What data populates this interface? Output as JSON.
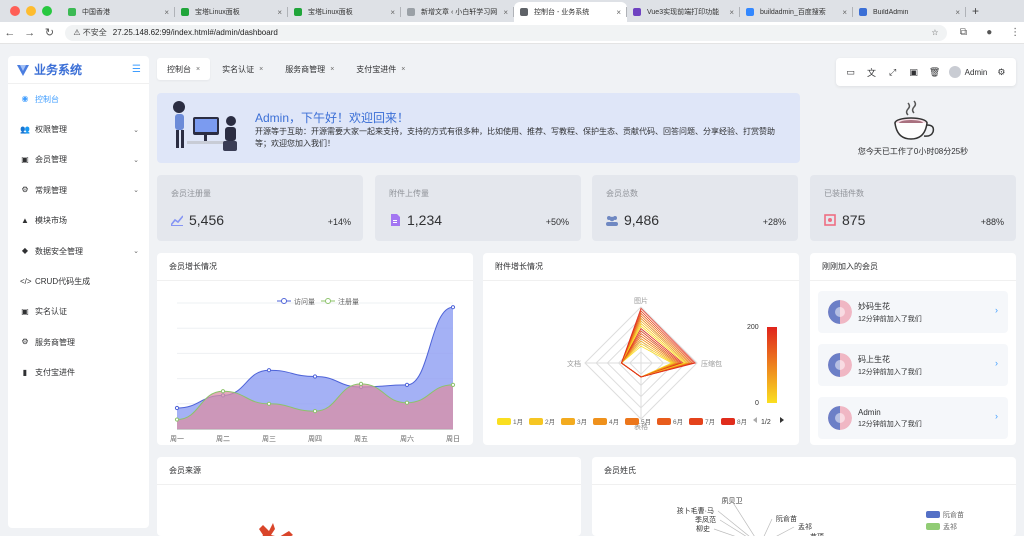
{
  "browser": {
    "tabs": [
      {
        "label": "中国香港",
        "color": "#3cba54"
      },
      {
        "label": "宝塔Linux面板",
        "color": "#20a53a"
      },
      {
        "label": "宝塔Linux面板",
        "color": "#20a53a"
      },
      {
        "label": "新增文章 ‹ 小白轩学习网",
        "color": "#9aa0a6"
      },
      {
        "label": "控制台 - 业务系统",
        "color": "#5f6368"
      },
      {
        "label": "Vue3实现前端打印功能",
        "color": "#6f42c1"
      },
      {
        "label": "buildadmin_百度搜索",
        "color": "#3388ff"
      },
      {
        "label": "BuildAdmin",
        "color": "#3b6fd6"
      }
    ],
    "active_tab": 4,
    "security_label": "不安全",
    "url": "27.25.148.62:99/index.html#/admin/dashboard"
  },
  "sidebar": {
    "title": "业务系统",
    "items": [
      {
        "label": "控制台",
        "icon": "gauge-icon",
        "glyph": "◉",
        "submenu": false
      },
      {
        "label": "权限管理",
        "icon": "users-icon",
        "glyph": "👥",
        "submenu": true
      },
      {
        "label": "会员管理",
        "icon": "id-card-icon",
        "glyph": "▣",
        "submenu": true
      },
      {
        "label": "常规管理",
        "icon": "cogs-icon",
        "glyph": "⚙",
        "submenu": true
      },
      {
        "label": "模块市场",
        "icon": "shopping-bag-icon",
        "glyph": "▲",
        "submenu": false
      },
      {
        "label": "数据安全管理",
        "icon": "shield-icon",
        "glyph": "◆",
        "submenu": true
      },
      {
        "label": "CRUD代码生成",
        "icon": "code-icon",
        "glyph": "</>",
        "submenu": false
      },
      {
        "label": "实名认证",
        "icon": "id-card-icon",
        "glyph": "▣",
        "submenu": false
      },
      {
        "label": "服务商管理",
        "icon": "gear-icon",
        "glyph": "⚙",
        "submenu": false
      },
      {
        "label": "支付宝进件",
        "icon": "bar-chart-icon",
        "glyph": "▮",
        "submenu": false
      }
    ],
    "active_index": 0
  },
  "page_tabs": [
    "控制台",
    "实名认证",
    "服务商管理",
    "支付宝进件"
  ],
  "toolbar": {
    "user": "Admin"
  },
  "welcome": {
    "title": "Admin，下午好！欢迎回来！",
    "text": "开源等于互助：开源需要大家一起来支持，支持的方式有很多种，比如使用、推荐、写教程、保护生态、贡献代码、回答问题、分享经验、打赏赞助等；欢迎您加入我们！"
  },
  "worktime": "您今天已工作了0小时08分25秒",
  "stats": [
    {
      "label": "会员注册量",
      "value": "5,456",
      "pct": "+14%",
      "color": "#8595f4"
    },
    {
      "label": "附件上传量",
      "value": "1,234",
      "pct": "+50%",
      "color": "#a376f2"
    },
    {
      "label": "会员总数",
      "value": "9,486",
      "pct": "+28%",
      "color": "#6f88c2"
    },
    {
      "label": "已装插件数",
      "value": "875",
      "pct": "+88%",
      "color": "#ee6e82"
    }
  ],
  "cards": {
    "growth": "会员增长情况",
    "attach": "附件增长情况",
    "newmembers": "刚刚加入的会员",
    "source": "会员来源",
    "surname": "会员姓氏"
  },
  "chart_data": [
    {
      "type": "area",
      "title": "会员增长情况",
      "categories": [
        "周一",
        "周二",
        "周三",
        "周四",
        "周五",
        "周六",
        "周日"
      ],
      "series": [
        {
          "name": "访问量",
          "values": [
            100,
            160,
            280,
            250,
            200,
            210,
            580
          ],
          "color": "#8d9ef2"
        },
        {
          "name": "注册量",
          "values": [
            45,
            180,
            120,
            85,
            215,
            125,
            210
          ],
          "color": "#d98fa4"
        }
      ],
      "ylim": [
        0,
        600
      ]
    },
    {
      "type": "radar",
      "title": "附件增长情况",
      "indicators": [
        "图片",
        "压缩包",
        "表格",
        "文档"
      ],
      "legend": [
        "1月",
        "2月",
        "3月",
        "4月",
        "5月",
        "6月",
        "7月",
        "8月"
      ],
      "legend_colors": [
        "#fadf20",
        "#f6c623",
        "#f3ab1f",
        "#ef911c",
        "#ec761b",
        "#e85c1c",
        "#e4421b",
        "#e02c1c"
      ],
      "legend_page": "1/2",
      "visualmap": {
        "min": "0",
        "max": "200"
      }
    },
    {
      "type": "bar",
      "title": "会员姓氏",
      "labels": [
        "夙贝卫",
        "孩卜毛曹·马",
        "季凤范",
        "柳史",
        "阮俞苗",
        "孟祁",
        "苗项"
      ],
      "legend": [
        {
          "name": "阮俞苗",
          "color": "#5470c6"
        },
        {
          "name": "孟祁",
          "color": "#91cc75"
        }
      ]
    }
  ],
  "new_members": [
    {
      "name": "妙码生花",
      "time": "12分钟前加入了我们"
    },
    {
      "name": "码上生花",
      "time": "12分钟前加入了我们"
    },
    {
      "name": "Admin",
      "time": "12分钟前加入了我们"
    }
  ]
}
